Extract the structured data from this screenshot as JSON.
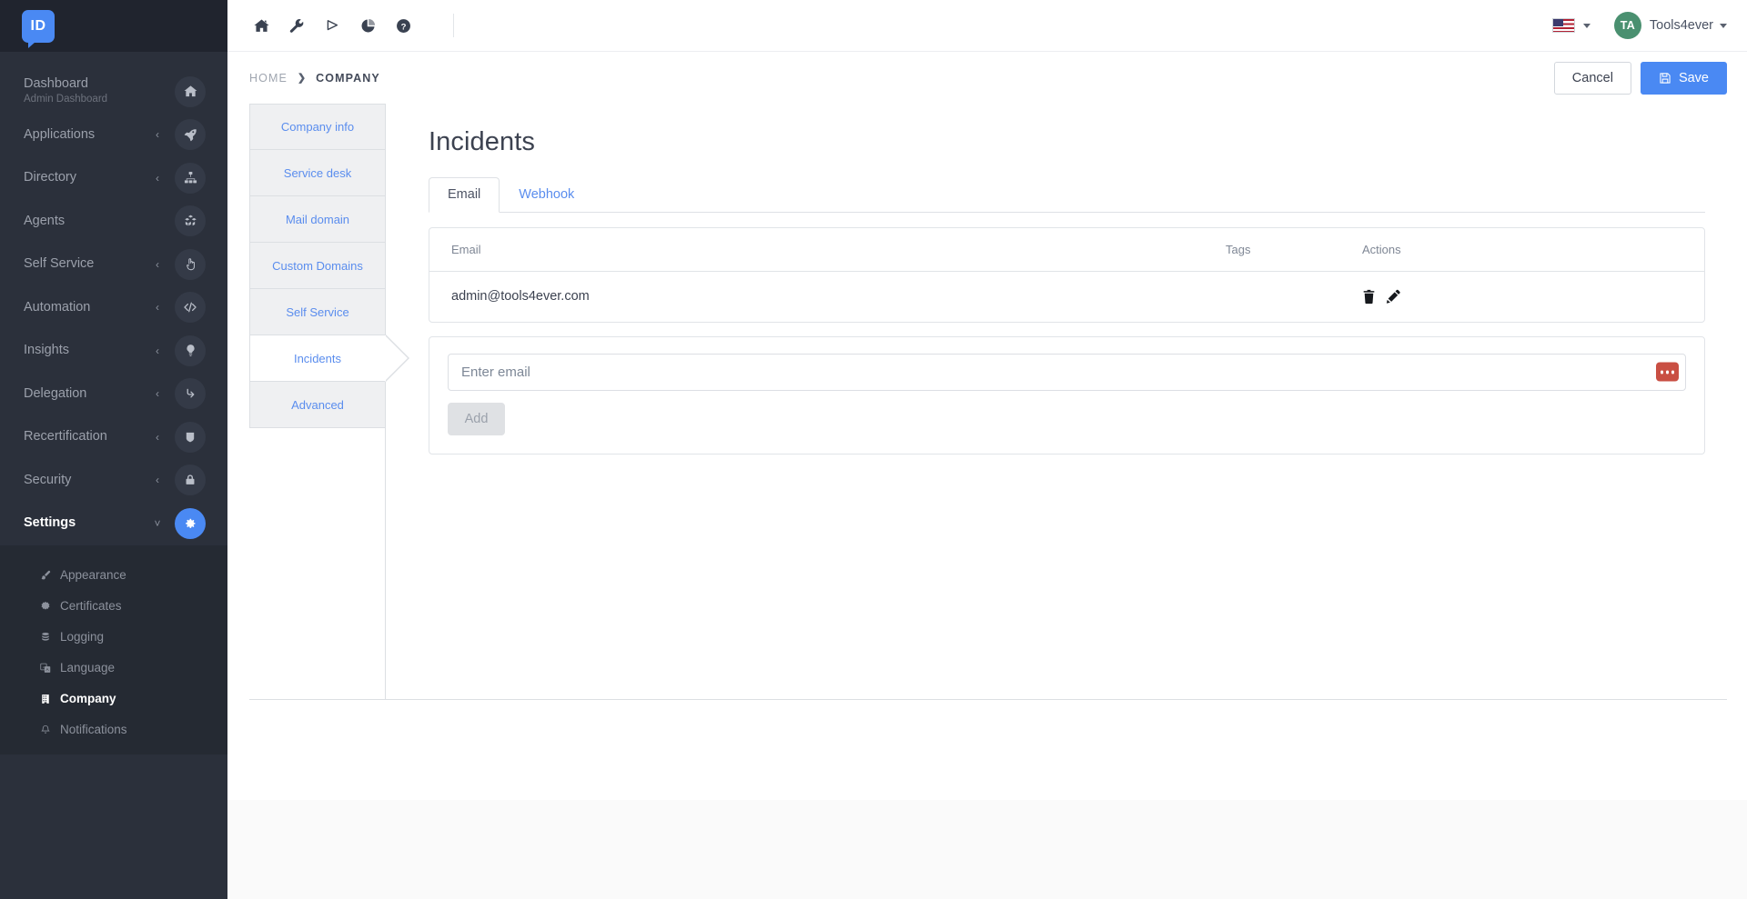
{
  "brand": {
    "logo_text": "ID"
  },
  "sidebar": {
    "items": [
      {
        "label": "Dashboard",
        "sub": "Admin Dashboard",
        "icon": "home-icon",
        "caret": "",
        "active": false
      },
      {
        "label": "Applications",
        "sub": "",
        "icon": "rocket-icon",
        "caret": "‹",
        "active": false
      },
      {
        "label": "Directory",
        "sub": "",
        "icon": "sitemap-icon",
        "caret": "‹",
        "active": false
      },
      {
        "label": "Agents",
        "sub": "",
        "icon": "cubes-icon",
        "caret": "",
        "active": false
      },
      {
        "label": "Self Service",
        "sub": "",
        "icon": "hand-pointer-icon",
        "caret": "‹",
        "active": false
      },
      {
        "label": "Automation",
        "sub": "",
        "icon": "code-icon",
        "caret": "‹",
        "active": false
      },
      {
        "label": "Insights",
        "sub": "",
        "icon": "lightbulb-icon",
        "caret": "‹",
        "active": false
      },
      {
        "label": "Delegation",
        "sub": "",
        "icon": "arrow-turn-down-icon",
        "caret": "‹",
        "active": false
      },
      {
        "label": "Recertification",
        "sub": "",
        "icon": "shield-icon",
        "caret": "‹",
        "active": false
      },
      {
        "label": "Security",
        "sub": "",
        "icon": "lock-icon",
        "caret": "‹",
        "active": false
      },
      {
        "label": "Settings",
        "sub": "",
        "icon": "gear-icon",
        "caret": "˅",
        "active": true
      }
    ],
    "submenu": [
      {
        "label": "Appearance",
        "icon": "paintbrush-icon",
        "glyph": "🖌",
        "active": false
      },
      {
        "label": "Certificates",
        "icon": "certificate-icon",
        "glyph": "✸",
        "active": false
      },
      {
        "label": "Logging",
        "icon": "database-icon",
        "glyph": "☰",
        "active": false
      },
      {
        "label": "Language",
        "icon": "language-icon",
        "glyph": "文",
        "active": false
      },
      {
        "label": "Company",
        "icon": "building-icon",
        "glyph": "▦",
        "active": true
      },
      {
        "label": "Notifications",
        "icon": "bell-icon",
        "glyph": "🔔",
        "active": false
      }
    ]
  },
  "topbar": {
    "icons": [
      {
        "name": "home-icon"
      },
      {
        "name": "wrench-icon"
      },
      {
        "name": "flask-icon"
      },
      {
        "name": "pie-chart-icon"
      },
      {
        "name": "help-circle-icon"
      }
    ],
    "language": {
      "name": "flag-us-icon",
      "label": ""
    },
    "user": {
      "initials": "TA",
      "name": "Tools4ever"
    }
  },
  "breadcrumb": {
    "home": "HOME",
    "separator": "❯",
    "current": "COMPANY"
  },
  "actions": {
    "cancel_label": "Cancel",
    "save_label": "Save"
  },
  "vtabs": [
    {
      "label": "Company info",
      "active": false
    },
    {
      "label": "Service desk",
      "active": false
    },
    {
      "label": "Mail domain",
      "active": false
    },
    {
      "label": "Custom Domains",
      "active": false
    },
    {
      "label": "Self Service",
      "active": false
    },
    {
      "label": "Incidents",
      "active": true
    },
    {
      "label": "Advanced",
      "active": false
    }
  ],
  "pane": {
    "title": "Incidents",
    "tabs": [
      {
        "label": "Email",
        "active": true
      },
      {
        "label": "Webhook",
        "active": false
      }
    ],
    "table": {
      "columns": [
        "Email",
        "Tags",
        "Actions"
      ],
      "rows": [
        {
          "email": "admin@tools4ever.com",
          "tags": "",
          "actions": [
            "delete-icon",
            "edit-icon"
          ]
        }
      ]
    },
    "form": {
      "email_placeholder": "Enter email",
      "email_value": "",
      "badge": "ellipsis-badge",
      "add_label": "Add"
    }
  },
  "colors": {
    "sidebar_bg": "#2b303b",
    "sidebar_submenu_bg": "#252a33",
    "accent": "#4a89f3",
    "link": "#5a8dee",
    "avatar": "#4a9070",
    "badge_red": "#c94f43"
  }
}
